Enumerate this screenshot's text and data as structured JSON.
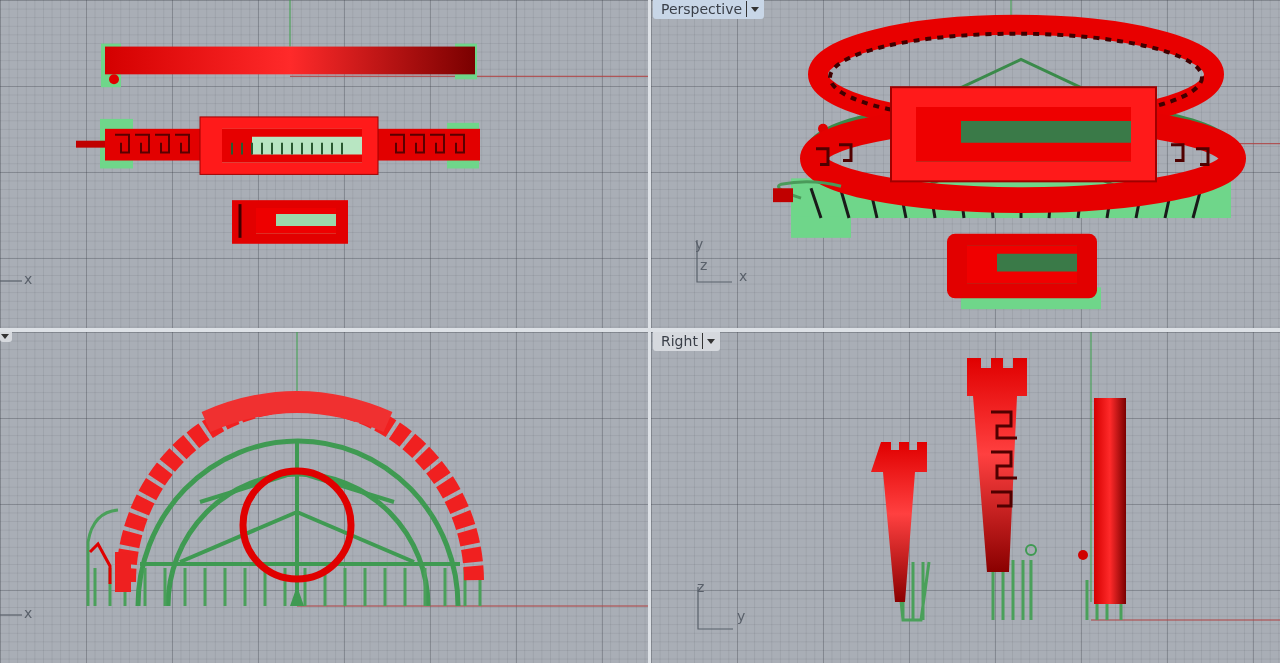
{
  "viewports": [
    {
      "kind": "top",
      "axis_labels": [
        "x"
      ]
    },
    {
      "kind": "perspective",
      "tab": {
        "label": "Perspective",
        "selected": true
      },
      "axis_labels": [
        "y",
        "z",
        "x"
      ]
    },
    {
      "kind": "front",
      "tab": {
        "selected": false
      },
      "axis_labels": [
        "x"
      ]
    },
    {
      "kind": "right",
      "tab": {
        "label": "Right",
        "selected": false
      },
      "axis_labels": [
        "z",
        "y"
      ]
    }
  ]
}
